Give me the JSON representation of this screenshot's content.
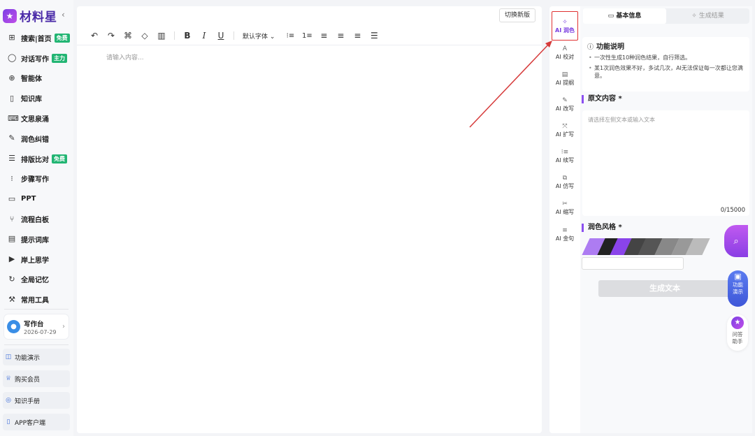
{
  "brand": {
    "name": "材料星",
    "logo_icon": "star-logo-icon"
  },
  "sidebar": {
    "collapse_icon": "chevron-left-icon",
    "items": [
      {
        "label": "搜索|首页",
        "icon": "grid-icon",
        "badge": "免费"
      },
      {
        "label": "对话写作",
        "icon": "chat-icon",
        "badge": "主力"
      },
      {
        "label": "智能体",
        "icon": "agent-icon",
        "badge": ""
      },
      {
        "label": "知识库",
        "icon": "book-icon",
        "badge": ""
      },
      {
        "label": "文思泉涌",
        "icon": "keyboard-icon",
        "badge": ""
      },
      {
        "label": "润色纠错",
        "icon": "pen-icon",
        "badge": ""
      },
      {
        "label": "排版比对",
        "icon": "lines-icon",
        "badge": "免费"
      },
      {
        "label": "步骤写作",
        "icon": "steps-icon",
        "badge": ""
      },
      {
        "label": "PPT",
        "icon": "presentation-icon",
        "badge": ""
      },
      {
        "label": "流程白板",
        "icon": "flow-icon",
        "badge": ""
      },
      {
        "label": "提示词库",
        "icon": "document-icon",
        "badge": ""
      },
      {
        "label": "岸上思学",
        "icon": "play-screen-icon",
        "badge": ""
      },
      {
        "label": "全局记忆",
        "icon": "memory-icon",
        "badge": ""
      },
      {
        "label": "常用工具",
        "icon": "wrench-icon",
        "badge": ""
      }
    ],
    "workspace": {
      "title": "写作台",
      "date": "2026-07-29"
    },
    "bottom": [
      {
        "label": "功能演示",
        "icon": "book-open-icon"
      },
      {
        "label": "购买会员",
        "icon": "crown-icon"
      },
      {
        "label": "知识手册",
        "icon": "compass-icon"
      },
      {
        "label": "APP客户端",
        "icon": "phone-icon"
      }
    ]
  },
  "editor": {
    "switch_label": "切换新版",
    "placeholder": "请输入内容...",
    "font_select": "默认字体"
  },
  "right_panel": {
    "tools": [
      {
        "label": "AI 润色",
        "icon": "sparkle-icon",
        "active": true
      },
      {
        "label": "AI 校对",
        "icon": "text-check-icon",
        "active": false
      },
      {
        "label": "AI 提纲",
        "icon": "outline-icon",
        "active": false
      },
      {
        "label": "AI 改写",
        "icon": "rewrite-icon",
        "active": false
      },
      {
        "label": "AI 扩写",
        "icon": "expand-icon",
        "active": false
      },
      {
        "label": "AI 续写",
        "icon": "continue-icon",
        "active": false
      },
      {
        "label": "AI 仿写",
        "icon": "copy-icon",
        "active": false
      },
      {
        "label": "AI 缩写",
        "icon": "scissors-icon",
        "active": false
      },
      {
        "label": "AI 金句",
        "icon": "quote-icon",
        "active": false
      }
    ],
    "tabs": [
      {
        "label": "基本信息",
        "active": true
      },
      {
        "label": "生成结果",
        "active": false
      }
    ],
    "description": {
      "title": "功能说明",
      "items": [
        "一次性生成10种润色结果，自行筛选。",
        "某1次润色效果不好，多试几次，AI无法保证每一次都让您满意。"
      ]
    },
    "original_title": "原文内容 *",
    "original_placeholder": "请选择左侧文本或输入文本",
    "counter": "0/15000",
    "style_title": "润色风格 *",
    "generate_label": "生成文本"
  },
  "floating": {
    "search_icon": "search-icon",
    "demo_label": "功能\n演示",
    "help_label": "问答\n助手"
  },
  "colors": {
    "accent": "#8b4ff0",
    "badge_green": "#22b573",
    "highlight_red": "#e03131"
  }
}
